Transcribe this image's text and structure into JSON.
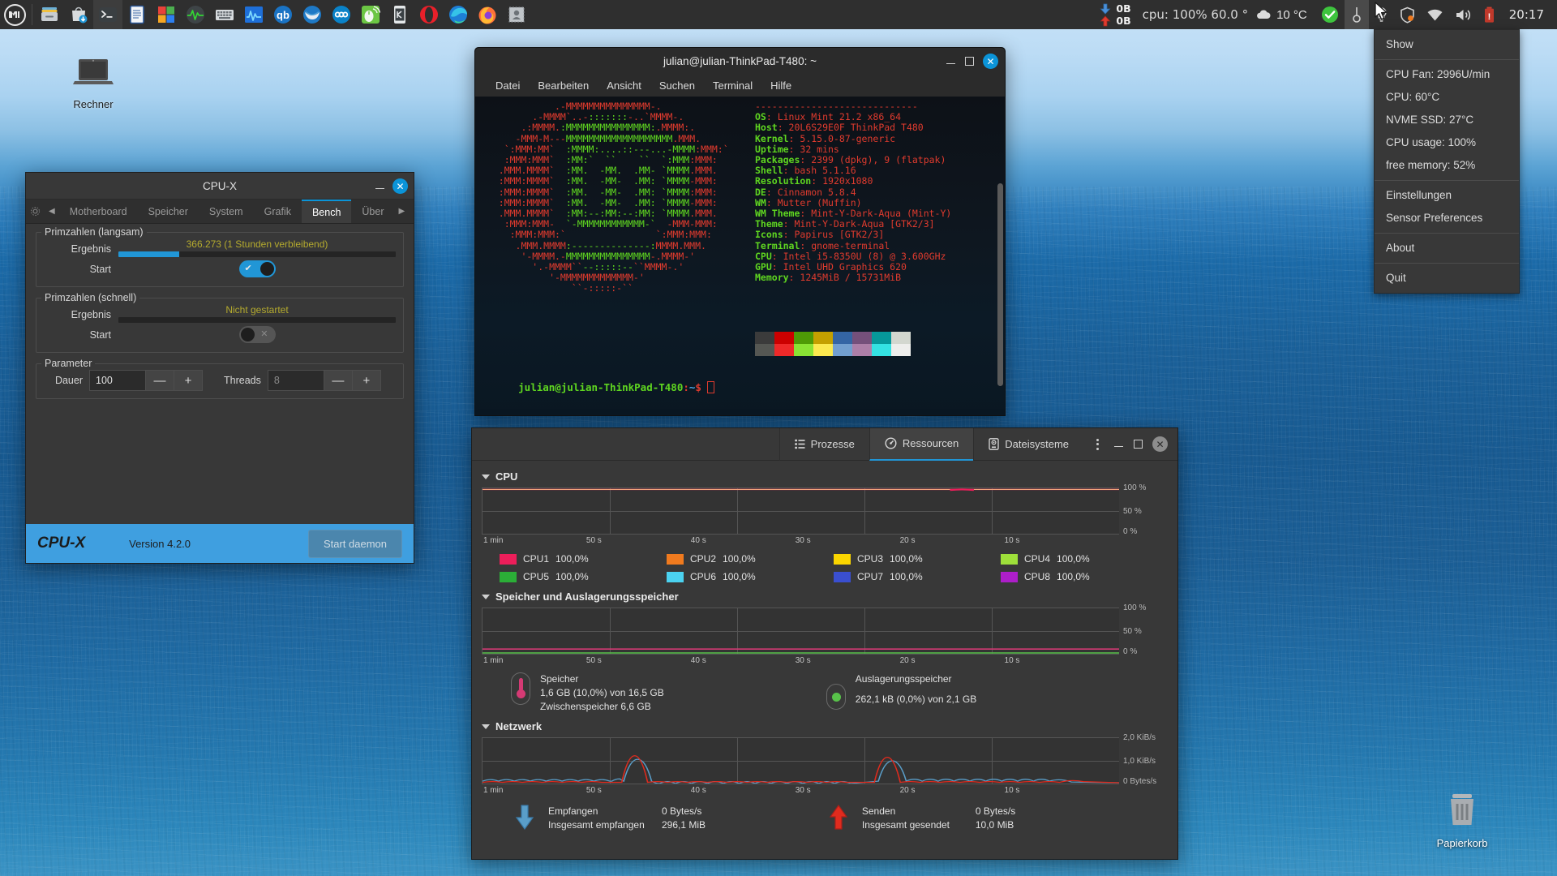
{
  "panel": {
    "menu_icon": "mint-menu-icon",
    "launchers": [
      {
        "name": "files-icon",
        "label": "Dateien"
      },
      {
        "name": "software-manager-icon",
        "label": "Anwendungsverwaltung"
      },
      {
        "name": "terminal-icon",
        "label": "Terminal"
      },
      {
        "name": "libreoffice-writer-icon",
        "label": "LibreOffice Writer"
      },
      {
        "name": "microsoft-office-icon",
        "label": "Office"
      },
      {
        "name": "system-monitor-icon",
        "label": "Systemüberwachung"
      },
      {
        "name": "onboard-keyboard-icon",
        "label": "Bildschirmtastatur"
      },
      {
        "name": "psensor-icon",
        "label": "Psensor"
      },
      {
        "name": "qbittorrent-icon",
        "label": "qBittorrent"
      },
      {
        "name": "thunderbird-icon",
        "label": "Thunderbird"
      },
      {
        "name": "nextcloud-icon",
        "label": "Nextcloud"
      },
      {
        "name": "mouse-settings-icon",
        "label": "Maus"
      },
      {
        "name": "kde-connect-icon",
        "label": "KDE Connect"
      },
      {
        "name": "opera-icon",
        "label": "Opera"
      },
      {
        "name": "microsoft-edge-icon",
        "label": "Microsoft Edge"
      },
      {
        "name": "firefox-icon",
        "label": "Firefox"
      },
      {
        "name": "stamp-app-icon",
        "label": "Briefmarke"
      }
    ],
    "net_download": "0B",
    "net_upload": "0B",
    "cpu_text": "cpu: 100%  60.0 °",
    "weather_temp": "10 °C",
    "clock": "20:17",
    "tray": [
      {
        "name": "update-manager-icon"
      },
      {
        "name": "psensor-tray-icon"
      },
      {
        "name": "night-light-icon"
      },
      {
        "name": "shield-icon"
      },
      {
        "name": "network-wifi-icon"
      },
      {
        "name": "volume-icon"
      },
      {
        "name": "battery-icon"
      }
    ]
  },
  "tray_menu": {
    "groups": [
      [
        "Show"
      ],
      [
        "CPU Fan: 2996U/min",
        "CPU: 60°C",
        "NVME SSD: 27°C",
        "CPU usage: 100%",
        "free memory: 52%"
      ],
      [
        "Einstellungen",
        "Sensor Preferences"
      ],
      [
        "About"
      ],
      [
        "Quit"
      ]
    ]
  },
  "desktop_icons": [
    {
      "name": "computer-icon",
      "label": "Rechner"
    },
    {
      "name": "trash-icon",
      "label": "Papierkorb"
    }
  ],
  "cpux": {
    "title": "CPU-X",
    "tabs": [
      "Motherboard",
      "Speicher",
      "System",
      "Grafik",
      "Bench",
      "Über"
    ],
    "selected_tab": "Bench",
    "slow": {
      "legend": "Primzahlen (langsam)",
      "result_label": "Ergebnis",
      "result_value": "366.273 (1 Stunden verbleibend)",
      "progress_percent": 22,
      "start_label": "Start",
      "start_state": "on"
    },
    "fast": {
      "legend": "Primzahlen (schnell)",
      "result_label": "Ergebnis",
      "result_value": "Nicht gestartet",
      "progress_percent": 0,
      "start_label": "Start",
      "start_state": "off"
    },
    "parameters": {
      "legend": "Parameter",
      "duration_label": "Dauer",
      "duration_value": "100",
      "threads_label": "Threads",
      "threads_value": "8",
      "minus": "—",
      "plus": "+"
    },
    "footer": {
      "brand": "CPU-X",
      "version": "Version 4.2.0",
      "daemon_button": "Start daemon"
    }
  },
  "terminal": {
    "title": "julian@julian-ThinkPad-T480: ~",
    "menus": [
      "Datei",
      "Bearbeiten",
      "Ansicht",
      "Suchen",
      "Terminal",
      "Hilfe"
    ],
    "neofetch": {
      "separator": "-----------------------------",
      "rows": [
        {
          "key": "OS",
          "value": "Linux Mint 21.2 x86_64"
        },
        {
          "key": "Host",
          "value": "20L6S29E0F ThinkPad T480"
        },
        {
          "key": "Kernel",
          "value": "5.15.0-87-generic"
        },
        {
          "key": "Uptime",
          "value": "32 mins"
        },
        {
          "key": "Packages",
          "value": "2399 (dpkg), 9 (flatpak)"
        },
        {
          "key": "Shell",
          "value": "bash 5.1.16"
        },
        {
          "key": "Resolution",
          "value": "1920x1080"
        },
        {
          "key": "DE",
          "value": "Cinnamon 5.8.4"
        },
        {
          "key": "WM",
          "value": "Mutter (Muffin)"
        },
        {
          "key": "WM Theme",
          "value": "Mint-Y-Dark-Aqua (Mint-Y)"
        },
        {
          "key": "Theme",
          "value": "Mint-Y-Dark-Aqua [GTK2/3]"
        },
        {
          "key": "Icons",
          "value": "Papirus [GTK2/3]"
        },
        {
          "key": "Terminal",
          "value": "gnome-terminal"
        },
        {
          "key": "CPU",
          "value": "Intel i5-8350U (8) @ 3.600GHz"
        },
        {
          "key": "GPU",
          "value": "Intel UHD Graphics 620"
        },
        {
          "key": "Memory",
          "value": "1245MiB / 15731MiB"
        }
      ],
      "swatches_dark": [
        "#3b3b3b",
        "#cc0000",
        "#4e9a06",
        "#c4a000",
        "#3465a4",
        "#75507b",
        "#06989a",
        "#d3d7cf"
      ],
      "swatches_light": [
        "#555753",
        "#ef2929",
        "#8ae234",
        "#fce94f",
        "#729fcf",
        "#ad7fa8",
        "#34e2e2",
        "#eeeeec"
      ]
    },
    "prompt": {
      "user_host": "julian@julian-ThinkPad-T480",
      "colon": ":",
      "path": "~",
      "dollar": "$"
    }
  },
  "sysmon": {
    "tabs": [
      {
        "label": "Prozesse",
        "icon": "list-icon",
        "selected": false
      },
      {
        "label": "Ressourcen",
        "icon": "gauge-icon",
        "selected": true
      },
      {
        "label": "Dateisysteme",
        "icon": "disk-icon",
        "selected": false
      }
    ],
    "cpu": {
      "title": "CPU",
      "y_labels": [
        "100 %",
        "50 %",
        "0 %"
      ],
      "x_labels": [
        "1 min",
        "50 s",
        "40 s",
        "30 s",
        "20 s",
        "10 s"
      ],
      "cores": [
        {
          "name": "CPU1",
          "value": "100,0%",
          "color": "#ec1e5a"
        },
        {
          "name": "CPU2",
          "value": "100,0%",
          "color": "#f07a1e"
        },
        {
          "name": "CPU3",
          "value": "100,0%",
          "color": "#fbd600"
        },
        {
          "name": "CPU4",
          "value": "100,0%",
          "color": "#9ee03a"
        },
        {
          "name": "CPU5",
          "value": "100,0%",
          "color": "#2bae37"
        },
        {
          "name": "CPU6",
          "value": "100,0%",
          "color": "#4bd2f0"
        },
        {
          "name": "CPU7",
          "value": "100,0%",
          "color": "#3a4fd0"
        },
        {
          "name": "CPU8",
          "value": "100,0%",
          "color": "#ad1ec9"
        }
      ]
    },
    "memory": {
      "title": "Speicher und Auslagerungsspeicher",
      "y_labels": [
        "100 %",
        "50 %",
        "0 %"
      ],
      "x_labels": [
        "1 min",
        "50 s",
        "40 s",
        "30 s",
        "20 s",
        "10 s"
      ],
      "ram": {
        "name": "Speicher",
        "line1": "1,6 GB (10,0%) von 16,5 GB",
        "line2": "Zwischenspeicher 6,6 GB",
        "color": "#d53a74"
      },
      "swap": {
        "name": "Auslagerungsspeicher",
        "line1": "262,1 kB (0,0%) von 2,1 GB",
        "color": "#58c24a"
      }
    },
    "network": {
      "title": "Netzwerk",
      "y_labels": [
        "2,0 KiB/s",
        "1,0 KiB/s",
        "0 Bytes/s"
      ],
      "x_labels": [
        "1 min",
        "50 s",
        "40 s",
        "30 s",
        "20 s",
        "10 s"
      ],
      "receive": {
        "label": "Empfangen",
        "rate": "0 Bytes/s",
        "total_label": "Insgesamt empfangen",
        "total": "296,1 MiB",
        "color": "#5a9ec9"
      },
      "send": {
        "label": "Senden",
        "rate": "0 Bytes/s",
        "total_label": "Insgesamt gesendet",
        "total": "10,0 MiB",
        "color": "#e02b1e"
      }
    }
  },
  "chart_data": [
    {
      "type": "line",
      "title": "CPU",
      "xlabel": "",
      "ylabel": "%",
      "ylim": [
        0,
        100
      ],
      "x_ticks": [
        "1 min",
        "50 s",
        "40 s",
        "30 s",
        "20 s",
        "10 s"
      ],
      "y_ticks": [
        "0 %",
        "50 %",
        "100 %"
      ],
      "grid": true,
      "legend": "below",
      "series": [
        {
          "name": "CPU1",
          "color": "#ec1e5a",
          "values": [
            100,
            100,
            100,
            100,
            100,
            100,
            100,
            100,
            100,
            100,
            100,
            100
          ]
        },
        {
          "name": "CPU2",
          "color": "#f07a1e",
          "values": [
            100,
            100,
            100,
            100,
            100,
            100,
            100,
            100,
            100,
            100,
            100,
            100
          ]
        },
        {
          "name": "CPU3",
          "color": "#fbd600",
          "values": [
            100,
            100,
            100,
            100,
            100,
            100,
            100,
            100,
            100,
            100,
            100,
            100
          ]
        },
        {
          "name": "CPU4",
          "color": "#9ee03a",
          "values": [
            100,
            100,
            100,
            100,
            100,
            100,
            100,
            100,
            100,
            100,
            100,
            100
          ]
        },
        {
          "name": "CPU5",
          "color": "#2bae37",
          "values": [
            100,
            100,
            100,
            100,
            100,
            100,
            100,
            100,
            100,
            100,
            100,
            100
          ]
        },
        {
          "name": "CPU6",
          "color": "#4bd2f0",
          "values": [
            100,
            100,
            100,
            100,
            100,
            100,
            100,
            100,
            100,
            100,
            100,
            100
          ]
        },
        {
          "name": "CPU7",
          "color": "#3a4fd0",
          "values": [
            100,
            100,
            100,
            100,
            100,
            100,
            100,
            100,
            100,
            100,
            100,
            100
          ]
        },
        {
          "name": "CPU8",
          "color": "#ad1ec9",
          "values": [
            100,
            100,
            100,
            100,
            100,
            100,
            100,
            100,
            100,
            100,
            100,
            100
          ]
        }
      ]
    },
    {
      "type": "line",
      "title": "Speicher und Auslagerungsspeicher",
      "ylim": [
        0,
        100
      ],
      "x_ticks": [
        "1 min",
        "50 s",
        "40 s",
        "30 s",
        "20 s",
        "10 s"
      ],
      "y_ticks": [
        "0 %",
        "50 %",
        "100 %"
      ],
      "grid": true,
      "series": [
        {
          "name": "Speicher",
          "color": "#d53a74",
          "values": [
            10,
            10,
            10,
            10,
            10,
            10,
            10,
            10,
            10,
            10,
            10,
            10
          ]
        },
        {
          "name": "Auslagerungsspeicher",
          "color": "#58c24a",
          "values": [
            0,
            0,
            0,
            0,
            0,
            0,
            0,
            0,
            0,
            0,
            0,
            0
          ]
        }
      ]
    },
    {
      "type": "line",
      "title": "Netzwerk",
      "ylim": [
        0,
        2048
      ],
      "x_ticks": [
        "1 min",
        "50 s",
        "40 s",
        "30 s",
        "20 s",
        "10 s"
      ],
      "y_ticks": [
        "0 Bytes/s",
        "1,0 KiB/s",
        "2,0 KiB/s"
      ],
      "grid": true,
      "series": [
        {
          "name": "Empfangen",
          "color": "#5a9ec9",
          "values": [
            60,
            120,
            60,
            150,
            80,
            1400,
            90,
            70,
            110,
            60,
            1500,
            80,
            120,
            90,
            200,
            60
          ]
        },
        {
          "name": "Senden",
          "color": "#e02b1e",
          "values": [
            40,
            50,
            40,
            60,
            1200,
            90,
            40,
            50,
            60,
            40,
            1300,
            50,
            60,
            50,
            250,
            40
          ]
        }
      ]
    }
  ]
}
